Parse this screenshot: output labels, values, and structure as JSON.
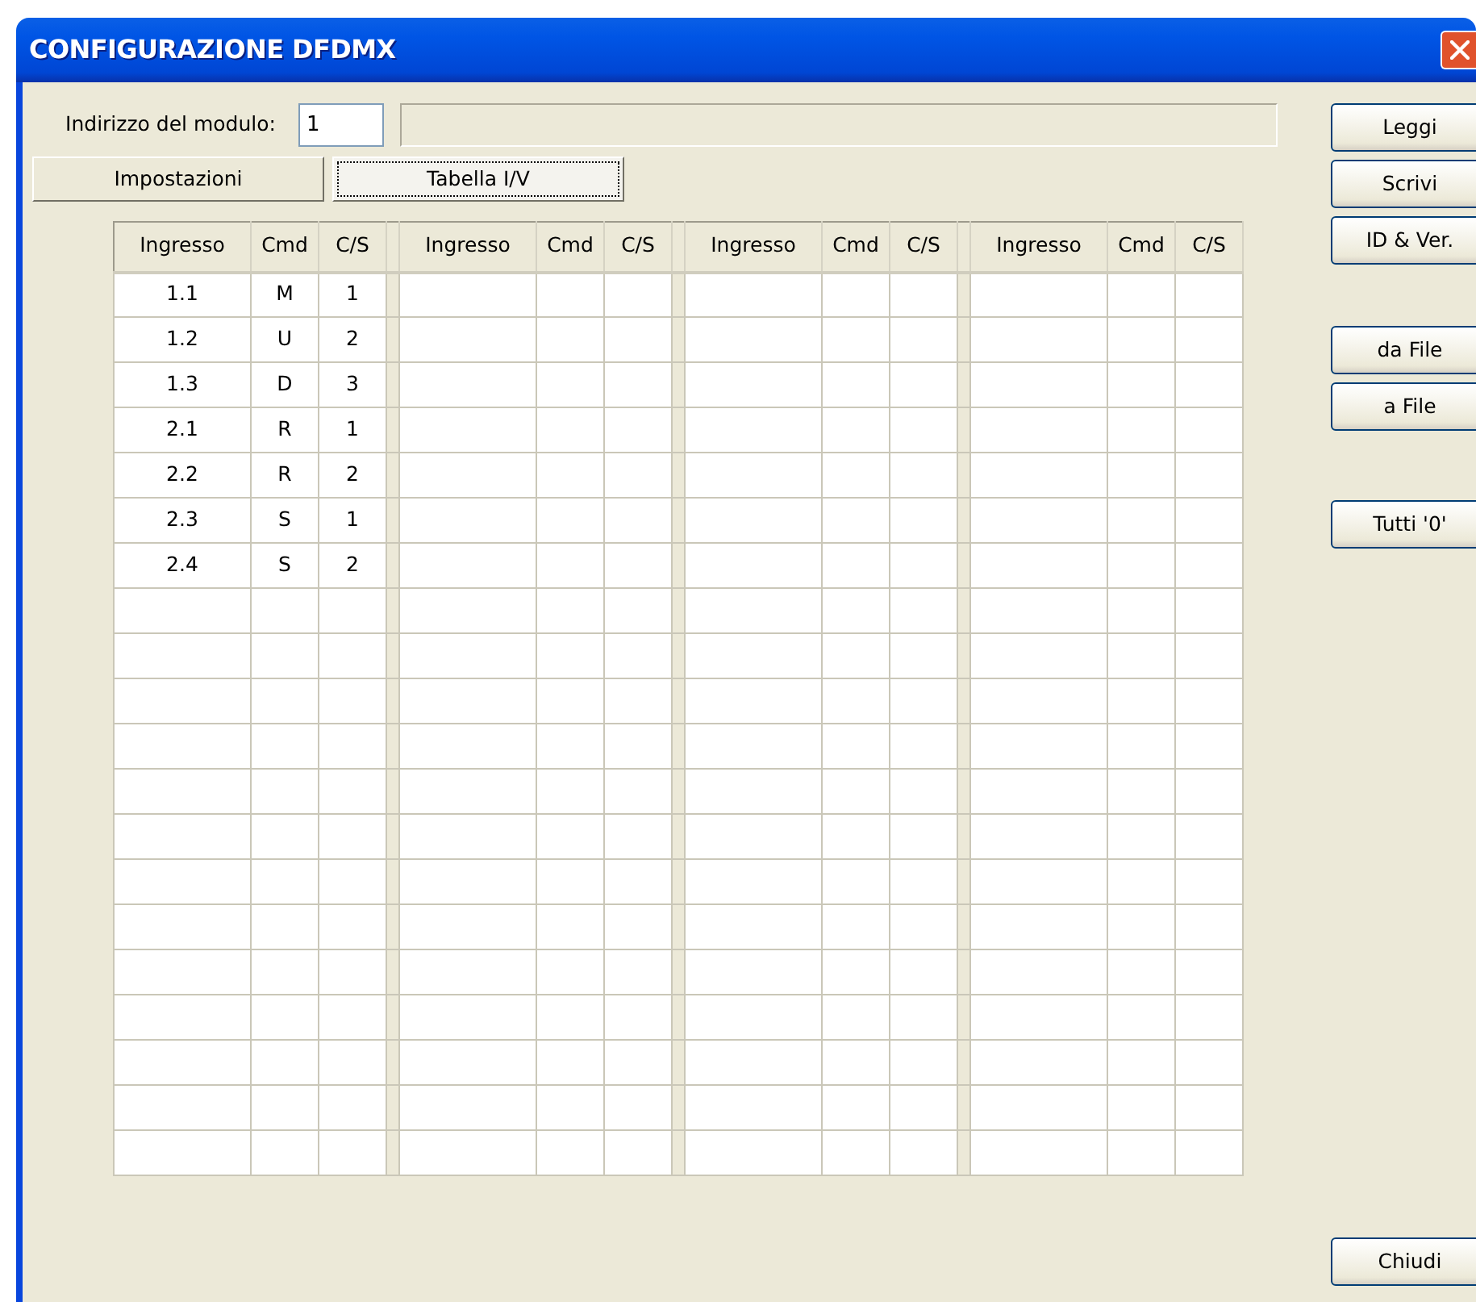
{
  "window": {
    "title": "CONFIGURAZIONE DFDMX"
  },
  "address": {
    "label": "Indirizzo del modulo:",
    "value": "1"
  },
  "tabs": [
    {
      "label": "Impostazioni",
      "selected": false
    },
    {
      "label": "Tabella I/V",
      "selected": true
    }
  ],
  "table": {
    "groups": [
      {
        "columns": [
          "Ingresso",
          "Cmd",
          "C/S"
        ]
      },
      {
        "columns": [
          "Ingresso",
          "Cmd",
          "C/S"
        ]
      },
      {
        "columns": [
          "Ingresso",
          "Cmd",
          "C/S"
        ]
      },
      {
        "columns": [
          "Ingresso",
          "Cmd",
          "C/S"
        ]
      }
    ],
    "rows": [
      [
        "1.1",
        "M",
        "1"
      ],
      [
        "1.2",
        "U",
        "2"
      ],
      [
        "1.3",
        "D",
        "3"
      ],
      [
        "2.1",
        "R",
        "1"
      ],
      [
        "2.2",
        "R",
        "2"
      ],
      [
        "2.3",
        "S",
        "1"
      ],
      [
        "2.4",
        "S",
        "2"
      ]
    ]
  },
  "side_buttons": [
    {
      "label": "Leggi",
      "kind": "top"
    },
    {
      "label": "Scrivi",
      "kind": "top"
    },
    {
      "label": "ID & Ver.",
      "kind": "top"
    },
    {
      "label": "da File",
      "kind": "file"
    },
    {
      "label": "a File",
      "kind": "file"
    },
    {
      "label": "Tutti '0'",
      "kind": "reset"
    },
    {
      "label": "Chiudi",
      "kind": "bottom"
    }
  ]
}
